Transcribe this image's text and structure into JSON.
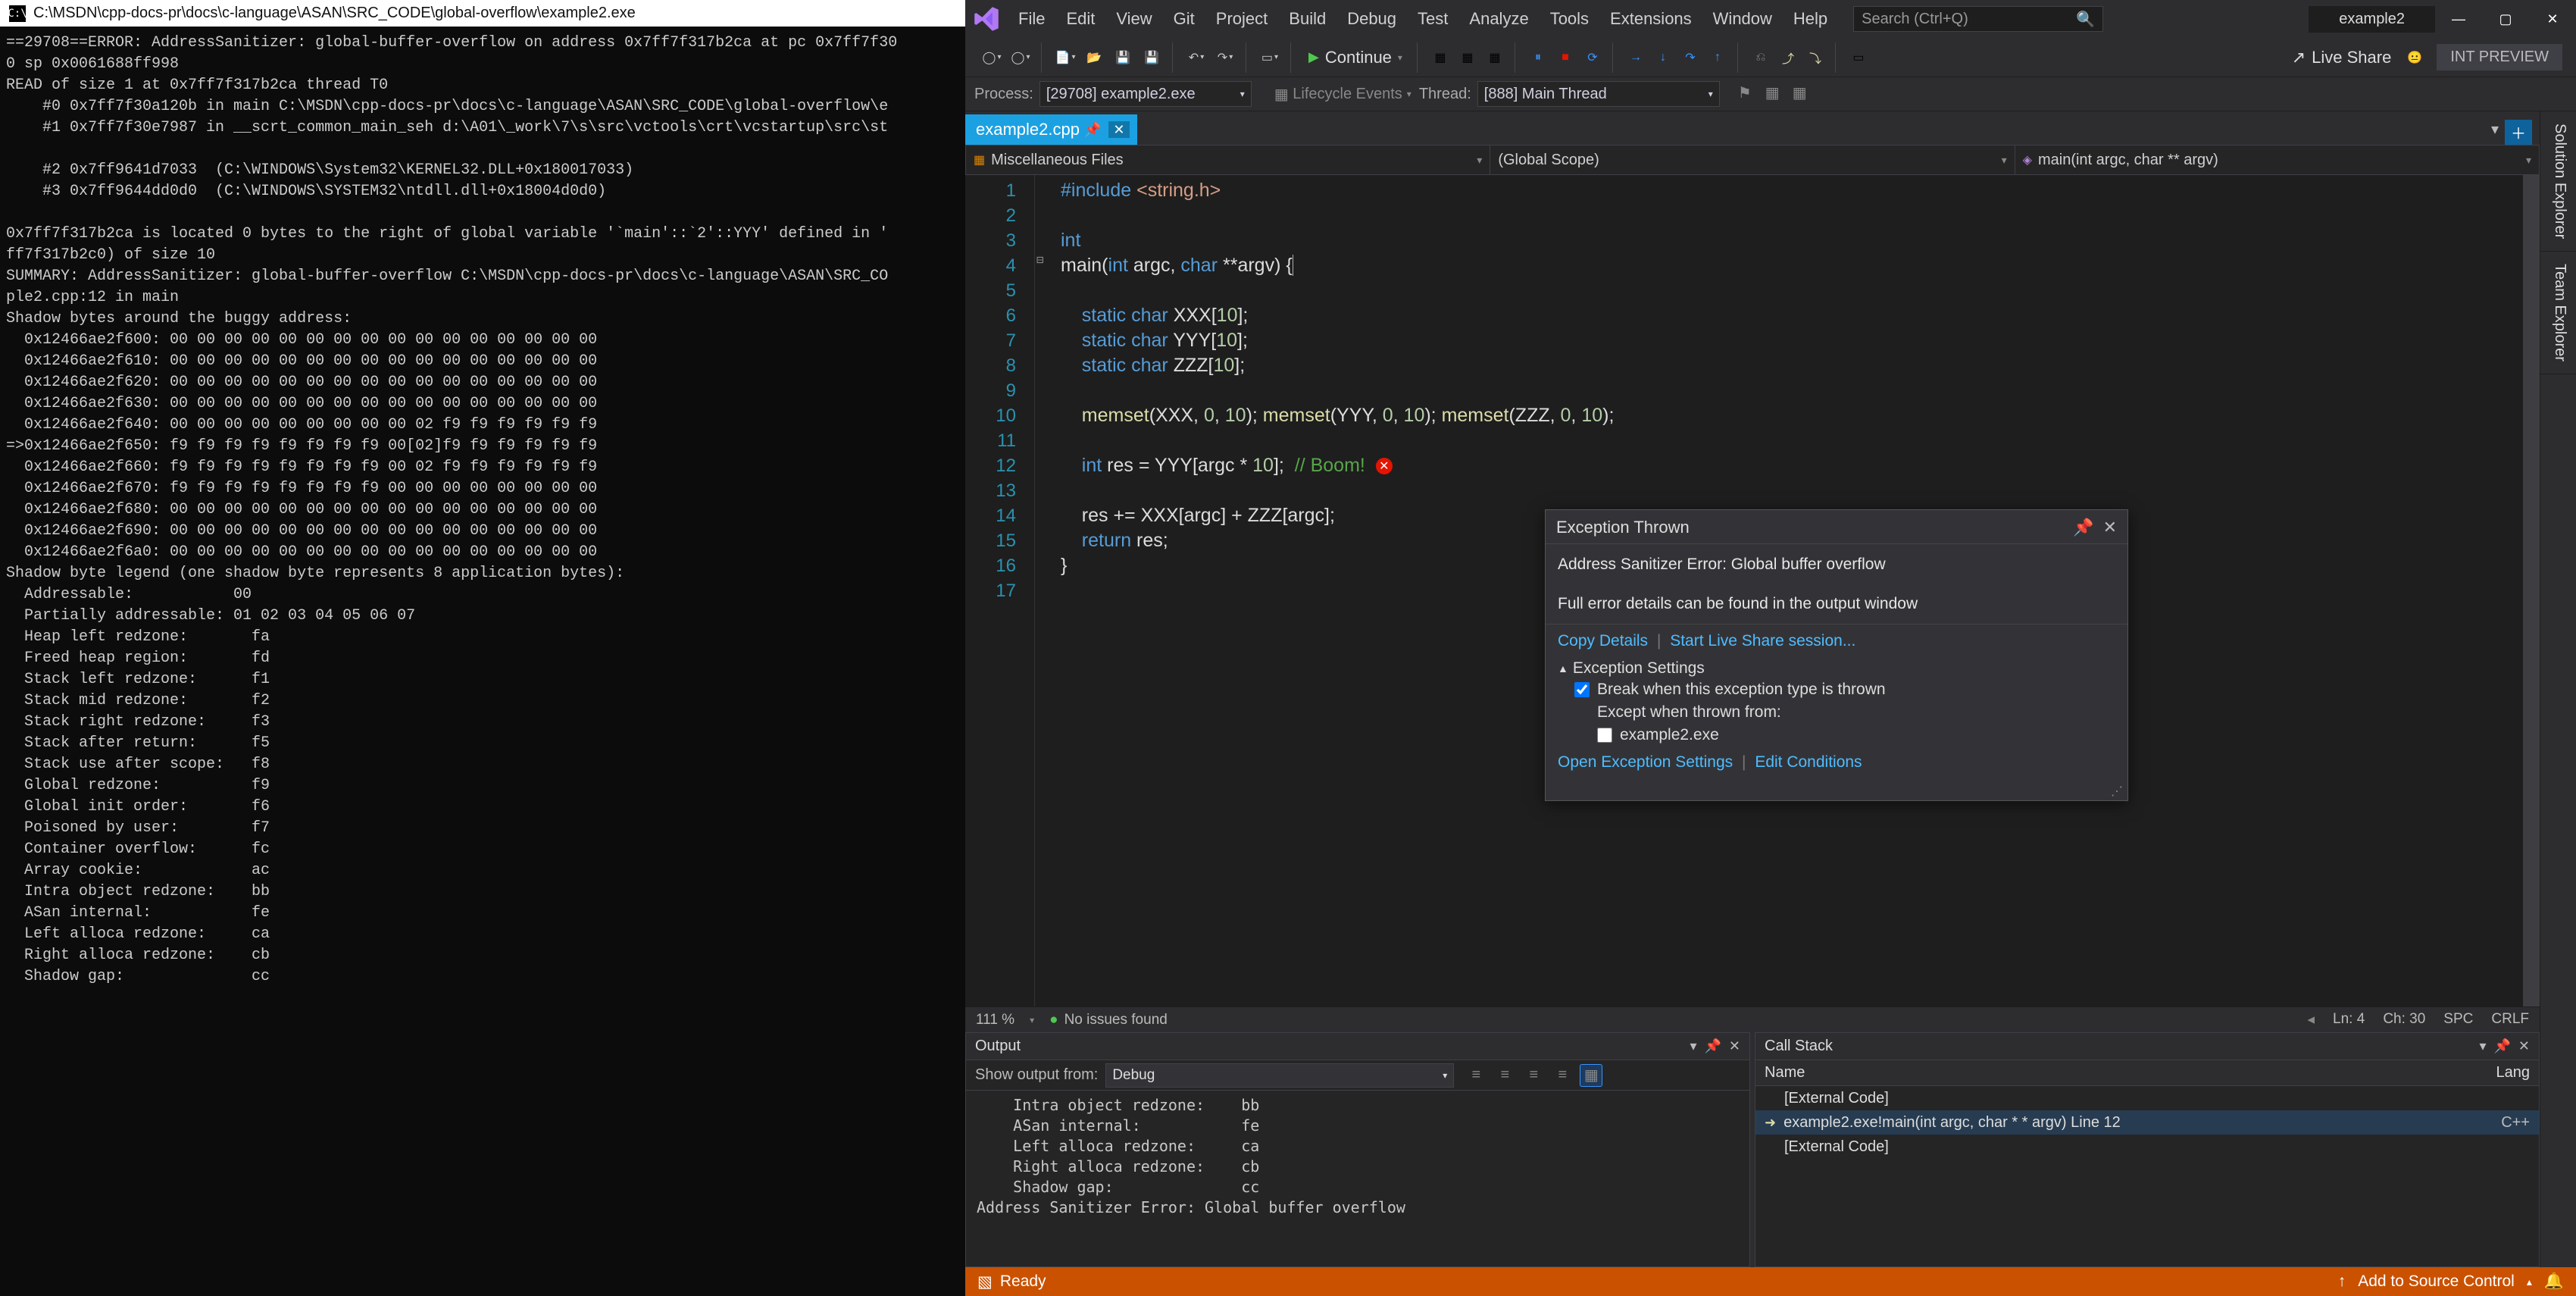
{
  "console": {
    "title": "C:\\MSDN\\cpp-docs-pr\\docs\\c-language\\ASAN\\SRC_CODE\\global-overflow\\example2.exe",
    "body": "==29708==ERROR: AddressSanitizer: global-buffer-overflow on address 0x7ff7f317b2ca at pc 0x7ff7f30\n0 sp 0x0061688ff998\nREAD of size 1 at 0x7ff7f317b2ca thread T0\n    #0 0x7ff7f30a120b in main C:\\MSDN\\cpp-docs-pr\\docs\\c-language\\ASAN\\SRC_CODE\\global-overflow\\e\n    #1 0x7ff7f30e7987 in __scrt_common_main_seh d:\\A01\\_work\\7\\s\\src\\vctools\\crt\\vcstartup\\src\\st\n\n    #2 0x7ff9641d7033  (C:\\WINDOWS\\System32\\KERNEL32.DLL+0x180017033)\n    #3 0x7ff9644dd0d0  (C:\\WINDOWS\\SYSTEM32\\ntdll.dll+0x18004d0d0)\n\n0x7ff7f317b2ca is located 0 bytes to the right of global variable '`main'::`2'::YYY' defined in '\nff7f317b2c0) of size 10\nSUMMARY: AddressSanitizer: global-buffer-overflow C:\\MSDN\\cpp-docs-pr\\docs\\c-language\\ASAN\\SRC_CO\nple2.cpp:12 in main\nShadow bytes around the buggy address:\n  0x12466ae2f600: 00 00 00 00 00 00 00 00 00 00 00 00 00 00 00 00\n  0x12466ae2f610: 00 00 00 00 00 00 00 00 00 00 00 00 00 00 00 00\n  0x12466ae2f620: 00 00 00 00 00 00 00 00 00 00 00 00 00 00 00 00\n  0x12466ae2f630: 00 00 00 00 00 00 00 00 00 00 00 00 00 00 00 00\n  0x12466ae2f640: 00 00 00 00 00 00 00 00 00 02 f9 f9 f9 f9 f9 f9\n=>0x12466ae2f650: f9 f9 f9 f9 f9 f9 f9 f9 00[02]f9 f9 f9 f9 f9 f9\n  0x12466ae2f660: f9 f9 f9 f9 f9 f9 f9 f9 00 02 f9 f9 f9 f9 f9 f9\n  0x12466ae2f670: f9 f9 f9 f9 f9 f9 f9 f9 00 00 00 00 00 00 00 00\n  0x12466ae2f680: 00 00 00 00 00 00 00 00 00 00 00 00 00 00 00 00\n  0x12466ae2f690: 00 00 00 00 00 00 00 00 00 00 00 00 00 00 00 00\n  0x12466ae2f6a0: 00 00 00 00 00 00 00 00 00 00 00 00 00 00 00 00\nShadow byte legend (one shadow byte represents 8 application bytes):\n  Addressable:           00\n  Partially addressable: 01 02 03 04 05 06 07\n  Heap left redzone:       fa\n  Freed heap region:       fd\n  Stack left redzone:      f1\n  Stack mid redzone:       f2\n  Stack right redzone:     f3\n  Stack after return:      f5\n  Stack use after scope:   f8\n  Global redzone:          f9\n  Global init order:       f6\n  Poisoned by user:        f7\n  Container overflow:      fc\n  Array cookie:            ac\n  Intra object redzone:    bb\n  ASan internal:           fe\n  Left alloca redzone:     ca\n  Right alloca redzone:    cb\n  Shadow gap:              cc"
  },
  "vs": {
    "menu": [
      "File",
      "Edit",
      "View",
      "Git",
      "Project",
      "Build",
      "Debug",
      "Test",
      "Analyze",
      "Tools",
      "Extensions",
      "Window",
      "Help"
    ],
    "search_placeholder": "Search (Ctrl+Q)",
    "solution": "example2",
    "toolbar": {
      "continue": "Continue",
      "live_share": "Live Share",
      "int_preview": "INT PREVIEW"
    },
    "debugbar": {
      "process_lbl": "Process:",
      "process_val": "[29708] example2.exe",
      "lifecycle": "Lifecycle Events",
      "thread_lbl": "Thread:",
      "thread_val": "[888] Main Thread"
    },
    "tabs": {
      "active": "example2.cpp"
    },
    "nav": {
      "project": "Miscellaneous Files",
      "scope": "(Global Scope)",
      "member": "main(int argc, char ** argv)"
    },
    "right_tabs": [
      "Solution Explorer",
      "Team Explorer"
    ],
    "editor_status": {
      "zoom": "111 %",
      "issues": "No issues found",
      "ln": "Ln: 4",
      "ch": "Ch: 30",
      "spc": "SPC",
      "crlf": "CRLF"
    },
    "lines": [
      "1",
      "2",
      "3",
      "4",
      "5",
      "6",
      "7",
      "8",
      "9",
      "10",
      "11",
      "12",
      "13",
      "14",
      "15",
      "16",
      "17"
    ]
  },
  "output": {
    "title": "Output",
    "show_from_lbl": "Show output from:",
    "show_from_val": "Debug",
    "body": "    Intra object redzone:    bb\n    ASan internal:           fe\n    Left alloca redzone:     ca\n    Right alloca redzone:    cb\n    Shadow gap:              cc\nAddress Sanitizer Error: Global buffer overflow"
  },
  "callstack": {
    "title": "Call Stack",
    "cols": {
      "name": "Name",
      "lang": "Lang"
    },
    "rows": [
      {
        "name": "[External Code]",
        "lang": "",
        "cur": false
      },
      {
        "name": "example2.exe!main(int argc, char * * argv) Line 12",
        "lang": "C++",
        "cur": true
      },
      {
        "name": "[External Code]",
        "lang": "",
        "cur": false
      }
    ]
  },
  "exception": {
    "title": "Exception Thrown",
    "message": "Address Sanitizer Error: Global buffer overflow",
    "details": "Full error details can be found in the output window",
    "copy": "Copy Details",
    "liveshare": "Start Live Share session...",
    "settings_hdr": "Exception Settings",
    "break_when": "Break when this exception type is thrown",
    "except_from": "Except when thrown from:",
    "except_item": "example2.exe",
    "open_settings": "Open Exception Settings",
    "edit_cond": "Edit Conditions"
  },
  "statusbar": {
    "ready": "Ready",
    "add_src": "Add to Source Control"
  }
}
